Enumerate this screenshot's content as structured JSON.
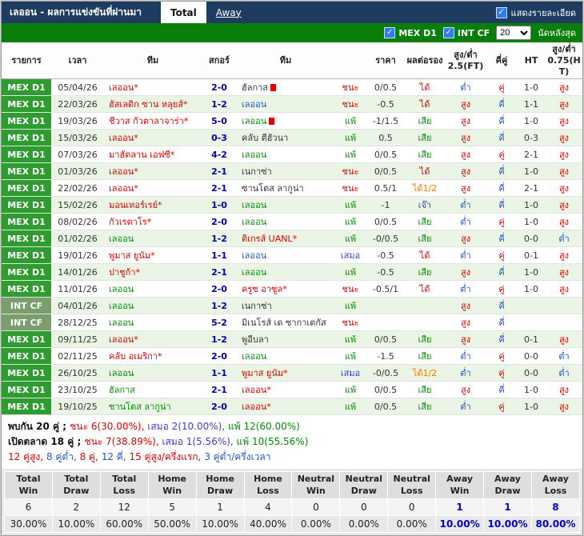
{
  "header": {
    "title": "เลออน - ผลการแข่งขันที่ผ่านมา",
    "tabs": [
      {
        "label": "Total",
        "active": true
      },
      {
        "label": "Away",
        "active": false
      }
    ],
    "show_details_label": "แสดงรายละเอียด"
  },
  "filter_bar": {
    "leagues": [
      {
        "label": "MEX D1",
        "checked": true
      },
      {
        "label": "INT CF",
        "checked": true
      }
    ],
    "match_count_value": "20",
    "match_count_label": "นัดหลังสุด"
  },
  "icons": {
    "check": "✓"
  },
  "colors": {
    "titlebar_bg": "#1d3c60",
    "filterbar_bg": "#0b7d0b",
    "mex_badge_bg": "#2f9c2f",
    "int_badge_bg": "#7b9e6d",
    "row_alt_bg": "#eaf5e5",
    "checkbox_bg": "#2f7df6",
    "away_stat_color": "#0000cc"
  },
  "palette": {
    "red": "#e00000",
    "green": "#009000",
    "blue": "#2255cc",
    "orange": "#f07800",
    "dark": "#333333",
    "draw": "#3b3bd6",
    "navy": "#0000b0"
  },
  "table": {
    "columns": [
      "รายการ",
      "เวลา",
      "ทีม",
      "สกอร์",
      "ทีม",
      "",
      "ราคา",
      "ผลต่อรอง",
      "สูง/ต่ำ 2.5(FT)",
      "คี่คู่",
      "HT",
      "สูง/ต่ำ 0.75(HT)"
    ],
    "rows": [
      {
        "league": "MEX D1",
        "date": "05/04/26",
        "home": {
          "name": "เลออน*",
          "color": "red",
          "red_card": false
        },
        "score": "2-0",
        "away": {
          "name": "ฮัลกาส",
          "color": "dark",
          "red_card": true
        },
        "result": {
          "text": "ชนะ",
          "color": "red"
        },
        "odds": "0/0.5",
        "handicap": {
          "text": "ได้",
          "color": "red"
        },
        "ou_ft": {
          "text": "ต่ำ",
          "color": "blue"
        },
        "odd_even": {
          "text": "คู่",
          "color": "red"
        },
        "ht": "1-0",
        "ou_ht": {
          "text": "สูง",
          "color": "red"
        }
      },
      {
        "league": "MEX D1",
        "date": "22/03/26",
        "home": {
          "name": "ฮัสเลติก ซาน หลุยส์*",
          "color": "red",
          "red_card": false
        },
        "score": "1-2",
        "away": {
          "name": "เลออน",
          "color": "blue",
          "red_card": false
        },
        "result": {
          "text": "ชนะ",
          "color": "red"
        },
        "odds": "-0.5",
        "handicap": {
          "text": "ได้",
          "color": "red"
        },
        "ou_ft": {
          "text": "สูง",
          "color": "red"
        },
        "odd_even": {
          "text": "คี่",
          "color": "blue"
        },
        "ht": "1-1",
        "ou_ht": {
          "text": "สูง",
          "color": "red"
        }
      },
      {
        "league": "MEX D1",
        "date": "19/03/26",
        "home": {
          "name": "ชีวาส กัวตาลาจาร่า*",
          "color": "red",
          "red_card": false
        },
        "score": "5-0",
        "away": {
          "name": "เลออน",
          "color": "green",
          "red_card": true
        },
        "result": {
          "text": "แพ้",
          "color": "green"
        },
        "odds": "-1/1.5",
        "handicap": {
          "text": "เสีย",
          "color": "green"
        },
        "ou_ft": {
          "text": "สูง",
          "color": "red"
        },
        "odd_even": {
          "text": "คี่",
          "color": "blue"
        },
        "ht": "1-0",
        "ou_ht": {
          "text": "สูง",
          "color": "red"
        }
      },
      {
        "league": "MEX D1",
        "date": "15/03/26",
        "home": {
          "name": "เลออน*",
          "color": "red",
          "red_card": false
        },
        "score": "0-3",
        "away": {
          "name": "คลับ ตีฮัวนา",
          "color": "dark",
          "red_card": false
        },
        "result": {
          "text": "แพ้",
          "color": "green"
        },
        "odds": "0.5",
        "handicap": {
          "text": "เสีย",
          "color": "green"
        },
        "ou_ft": {
          "text": "สูง",
          "color": "red"
        },
        "odd_even": {
          "text": "คี่",
          "color": "blue"
        },
        "ht": "0-3",
        "ou_ht": {
          "text": "สูง",
          "color": "red"
        }
      },
      {
        "league": "MEX D1",
        "date": "07/03/26",
        "home": {
          "name": "มาฮัตลาน เอฟซี*",
          "color": "red",
          "red_card": false
        },
        "score": "4-2",
        "away": {
          "name": "เลออน",
          "color": "green",
          "red_card": false
        },
        "result": {
          "text": "แพ้",
          "color": "green"
        },
        "odds": "0/0.5",
        "handicap": {
          "text": "เสีย",
          "color": "green"
        },
        "ou_ft": {
          "text": "สูง",
          "color": "red"
        },
        "odd_even": {
          "text": "คู่",
          "color": "red"
        },
        "ht": "2-1",
        "ou_ht": {
          "text": "สูง",
          "color": "red"
        }
      },
      {
        "league": "MEX D1",
        "date": "01/03/26",
        "home": {
          "name": "เลออน*",
          "color": "red",
          "red_card": false
        },
        "score": "2-1",
        "away": {
          "name": "เนกาซ่า",
          "color": "dark",
          "red_card": false
        },
        "result": {
          "text": "ชนะ",
          "color": "red"
        },
        "odds": "0/0.5",
        "handicap": {
          "text": "ได้",
          "color": "red"
        },
        "ou_ft": {
          "text": "สูง",
          "color": "red"
        },
        "odd_even": {
          "text": "คี่",
          "color": "blue"
        },
        "ht": "1-0",
        "ou_ht": {
          "text": "สูง",
          "color": "red"
        }
      },
      {
        "league": "MEX D1",
        "date": "22/02/26",
        "home": {
          "name": "เลออน*",
          "color": "red",
          "red_card": false
        },
        "score": "2-1",
        "away": {
          "name": "ซานโตส ลากูน่า",
          "color": "dark",
          "red_card": false
        },
        "result": {
          "text": "ชนะ",
          "color": "red"
        },
        "odds": "0.5/1",
        "handicap": {
          "text": "ได้1/2",
          "color": "orange"
        },
        "ou_ft": {
          "text": "สูง",
          "color": "red"
        },
        "odd_even": {
          "text": "คี่",
          "color": "blue"
        },
        "ht": "2-1",
        "ou_ht": {
          "text": "สูง",
          "color": "red"
        }
      },
      {
        "league": "MEX D1",
        "date": "15/02/26",
        "home": {
          "name": "มอนเทอร์เรย์*",
          "color": "red",
          "red_card": false
        },
        "score": "1-0",
        "away": {
          "name": "เลออน",
          "color": "green",
          "red_card": false
        },
        "result": {
          "text": "แพ้",
          "color": "green"
        },
        "odds": "-1",
        "handicap": {
          "text": "เจ๊า",
          "color": "blue"
        },
        "ou_ft": {
          "text": "ต่ำ",
          "color": "blue"
        },
        "odd_even": {
          "text": "คี่",
          "color": "blue"
        },
        "ht": "1-0",
        "ou_ht": {
          "text": "สูง",
          "color": "red"
        }
      },
      {
        "league": "MEX D1",
        "date": "08/02/26",
        "home": {
          "name": "กัวเรตาโร*",
          "color": "red",
          "red_card": false
        },
        "score": "2-0",
        "away": {
          "name": "เลออน",
          "color": "green",
          "red_card": false
        },
        "result": {
          "text": "แพ้",
          "color": "green"
        },
        "odds": "0/0.5",
        "handicap": {
          "text": "เสีย",
          "color": "green"
        },
        "ou_ft": {
          "text": "ต่ำ",
          "color": "blue"
        },
        "odd_even": {
          "text": "คู่",
          "color": "red"
        },
        "ht": "1-0",
        "ou_ht": {
          "text": "สูง",
          "color": "red"
        }
      },
      {
        "league": "MEX D1",
        "date": "01/02/26",
        "home": {
          "name": "เลออน",
          "color": "green",
          "red_card": false
        },
        "score": "1-2",
        "away": {
          "name": "ติเกรส์ UANL*",
          "color": "red",
          "red_card": false
        },
        "result": {
          "text": "แพ้",
          "color": "green"
        },
        "odds": "-0/0.5",
        "handicap": {
          "text": "เสีย",
          "color": "green"
        },
        "ou_ft": {
          "text": "สูง",
          "color": "red"
        },
        "odd_even": {
          "text": "คี่",
          "color": "blue"
        },
        "ht": "0-0",
        "ou_ht": {
          "text": "ต่ำ",
          "color": "blue"
        }
      },
      {
        "league": "MEX D1",
        "date": "19/01/26",
        "home": {
          "name": "พูมาส ยูนัม*",
          "color": "red",
          "red_card": false
        },
        "score": "1-1",
        "away": {
          "name": "เลออน",
          "color": "blue",
          "red_card": false
        },
        "result": {
          "text": "เสมอ",
          "color": "draw"
        },
        "odds": "-0.5",
        "handicap": {
          "text": "ได้",
          "color": "red"
        },
        "ou_ft": {
          "text": "ต่ำ",
          "color": "blue"
        },
        "odd_even": {
          "text": "คู่",
          "color": "red"
        },
        "ht": "0-1",
        "ou_ht": {
          "text": "สูง",
          "color": "red"
        }
      },
      {
        "league": "MEX D1",
        "date": "14/01/26",
        "home": {
          "name": "ปาชูก้า*",
          "color": "red",
          "red_card": false
        },
        "score": "2-1",
        "away": {
          "name": "เลออน",
          "color": "green",
          "red_card": false
        },
        "result": {
          "text": "แพ้",
          "color": "green"
        },
        "odds": "-0.5",
        "handicap": {
          "text": "เสีย",
          "color": "green"
        },
        "ou_ft": {
          "text": "สูง",
          "color": "red"
        },
        "odd_even": {
          "text": "คี่",
          "color": "blue"
        },
        "ht": "1-0",
        "ou_ht": {
          "text": "สูง",
          "color": "red"
        }
      },
      {
        "league": "MEX D1",
        "date": "11/01/26",
        "home": {
          "name": "เลออน",
          "color": "green",
          "red_card": false
        },
        "score": "2-0",
        "away": {
          "name": "ครูซ อาซูล*",
          "color": "red",
          "red_card": false
        },
        "result": {
          "text": "ชนะ",
          "color": "red"
        },
        "odds": "-0.5/1",
        "handicap": {
          "text": "ได้",
          "color": "red"
        },
        "ou_ft": {
          "text": "ต่ำ",
          "color": "blue"
        },
        "odd_even": {
          "text": "คู่",
          "color": "red"
        },
        "ht": "1-0",
        "ou_ht": {
          "text": "สูง",
          "color": "red"
        }
      },
      {
        "league": "INT CF",
        "date": "04/01/26",
        "home": {
          "name": "เลออน",
          "color": "green",
          "red_card": false
        },
        "score": "1-2",
        "away": {
          "name": "เนกาซ่า",
          "color": "dark",
          "red_card": false
        },
        "result": {
          "text": "แพ้",
          "color": "green"
        },
        "odds": "",
        "handicap": {
          "text": "",
          "color": "dark"
        },
        "ou_ft": {
          "text": "สูง",
          "color": "red"
        },
        "odd_even": {
          "text": "คี่",
          "color": "blue"
        },
        "ht": "",
        "ou_ht": {
          "text": "",
          "color": "dark"
        }
      },
      {
        "league": "INT CF",
        "date": "28/12/25",
        "home": {
          "name": "เลออน",
          "color": "green",
          "red_card": false
        },
        "score": "5-2",
        "away": {
          "name": "มิเนโรส์ เด ซากาเตกัส",
          "color": "dark",
          "red_card": false
        },
        "result": {
          "text": "ชนะ",
          "color": "red"
        },
        "odds": "",
        "handicap": {
          "text": "",
          "color": "dark"
        },
        "ou_ft": {
          "text": "สูง",
          "color": "red"
        },
        "odd_even": {
          "text": "คี่",
          "color": "blue"
        },
        "ht": "",
        "ou_ht": {
          "text": "",
          "color": "dark"
        }
      },
      {
        "league": "MEX D1",
        "date": "09/11/25",
        "home": {
          "name": "เลออน*",
          "color": "red",
          "red_card": false
        },
        "score": "1-2",
        "away": {
          "name": "พูอีบลา",
          "color": "dark",
          "red_card": false
        },
        "result": {
          "text": "แพ้",
          "color": "green"
        },
        "odds": "0/0.5",
        "handicap": {
          "text": "เสีย",
          "color": "green"
        },
        "ou_ft": {
          "text": "สูง",
          "color": "red"
        },
        "odd_even": {
          "text": "คี่",
          "color": "blue"
        },
        "ht": "0-1",
        "ou_ht": {
          "text": "สูง",
          "color": "red"
        }
      },
      {
        "league": "MEX D1",
        "date": "02/11/25",
        "home": {
          "name": "คลับ อเมริกา*",
          "color": "red",
          "red_card": false
        },
        "score": "2-0",
        "away": {
          "name": "เลออน",
          "color": "green",
          "red_card": false
        },
        "result": {
          "text": "แพ้",
          "color": "green"
        },
        "odds": "-1.5",
        "handicap": {
          "text": "เสีย",
          "color": "green"
        },
        "ou_ft": {
          "text": "ต่ำ",
          "color": "blue"
        },
        "odd_even": {
          "text": "คู่",
          "color": "red"
        },
        "ht": "0-0",
        "ou_ht": {
          "text": "ต่ำ",
          "color": "blue"
        }
      },
      {
        "league": "MEX D1",
        "date": "26/10/25",
        "home": {
          "name": "เลออน",
          "color": "green",
          "red_card": false
        },
        "score": "1-1",
        "away": {
          "name": "พูมาส ยูนัม*",
          "color": "red",
          "red_card": false
        },
        "result": {
          "text": "เสมอ",
          "color": "draw"
        },
        "odds": "-0/0.5",
        "handicap": {
          "text": "ได้1/2",
          "color": "orange"
        },
        "ou_ft": {
          "text": "ต่ำ",
          "color": "blue"
        },
        "odd_even": {
          "text": "คู่",
          "color": "red"
        },
        "ht": "0-0",
        "ou_ht": {
          "text": "ต่ำ",
          "color": "blue"
        }
      },
      {
        "league": "MEX D1",
        "date": "23/10/25",
        "home": {
          "name": "ฮัลกาส",
          "color": "green",
          "red_card": false
        },
        "score": "2-1",
        "away": {
          "name": "เลออน*",
          "color": "red",
          "red_card": false
        },
        "result": {
          "text": "แพ้",
          "color": "green"
        },
        "odds": "0/0.5",
        "handicap": {
          "text": "เสีย",
          "color": "green"
        },
        "ou_ft": {
          "text": "สูง",
          "color": "red"
        },
        "odd_even": {
          "text": "คี่",
          "color": "blue"
        },
        "ht": "1-0",
        "ou_ht": {
          "text": "สูง",
          "color": "red"
        }
      },
      {
        "league": "MEX D1",
        "date": "19/10/25",
        "home": {
          "name": "ซานโตส ลากูน่า",
          "color": "green",
          "red_card": false
        },
        "score": "2-0",
        "away": {
          "name": "เลออน*",
          "color": "red",
          "red_card": false
        },
        "result": {
          "text": "แพ้",
          "color": "green"
        },
        "odds": "0/0.5",
        "handicap": {
          "text": "เสีย",
          "color": "green"
        },
        "ou_ft": {
          "text": "ต่ำ",
          "color": "blue"
        },
        "odd_even": {
          "text": "คู่",
          "color": "red"
        },
        "ht": "1-0",
        "ou_ht": {
          "text": "สูง",
          "color": "red"
        }
      }
    ]
  },
  "summary": {
    "line1": {
      "prefix": "พบกัน 20 คู่ ;",
      "parts": [
        {
          "text": "ชนะ 6(30.00%),",
          "color": "red"
        },
        {
          "text": "เสมอ 2(10.00%),",
          "color": "draw"
        },
        {
          "text": "แพ้ 12(60.00%)",
          "color": "green"
        }
      ]
    },
    "line2": {
      "prefix": "เปิดตลาด 18 คู่ ;",
      "parts": [
        {
          "text": "ชนะ 7(38.89%),",
          "color": "red"
        },
        {
          "text": "เสมอ 1(5.56%),",
          "color": "draw"
        },
        {
          "text": "แพ้ 10(55.56%)",
          "color": "green"
        }
      ]
    },
    "line3": [
      {
        "text": "12 คู่สูง,",
        "color": "red"
      },
      {
        "text": "8 คู่ต่ำ,",
        "color": "blue"
      },
      {
        "text": "8 คู่,",
        "color": "red"
      },
      {
        "text": "12 คี่,",
        "color": "blue"
      },
      {
        "text": "15 คู่สูง/ครึ่งแรก,",
        "color": "red"
      },
      {
        "text": "3 คู่ต่ำ/ครึ่งเวลา",
        "color": "blue"
      }
    ]
  },
  "stats_table": {
    "headers": [
      "Total Win",
      "Total Draw",
      "Total Loss",
      "Home Win",
      "Home Draw",
      "Home Loss",
      "Neutral Win",
      "Neutral Draw",
      "Neutral Loss",
      "Away Win",
      "Away Draw",
      "Away Loss"
    ],
    "counts": [
      "6",
      "2",
      "12",
      "5",
      "1",
      "4",
      "0",
      "0",
      "0",
      "1",
      "1",
      "8"
    ],
    "percents": [
      "30.00%",
      "10.00%",
      "60.00%",
      "50.00%",
      "10.00%",
      "40.00%",
      "0.00%",
      "0.00%",
      "0.00%",
      "10.00%",
      "10.00%",
      "80.00%"
    ],
    "away_start": 9
  }
}
